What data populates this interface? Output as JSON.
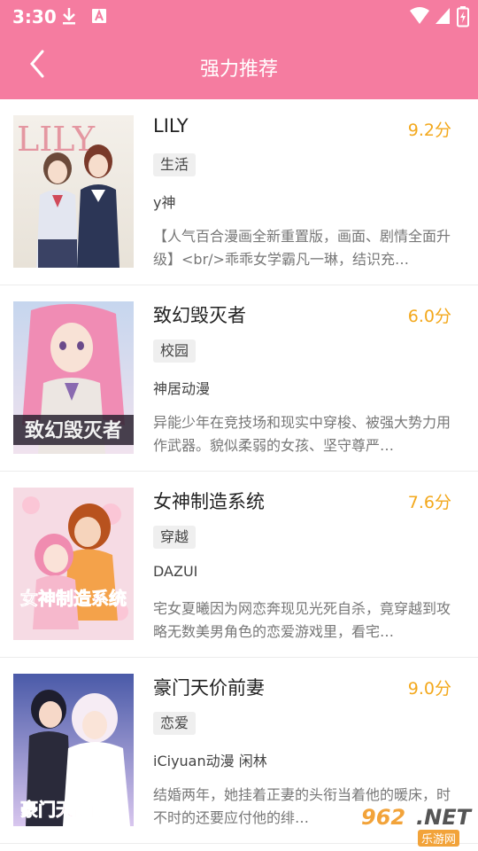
{
  "status_bar": {
    "time": "3:30"
  },
  "header": {
    "title": "强力推荐"
  },
  "comics": [
    {
      "name": "LILY",
      "score": "9.2分",
      "tag": "生活",
      "author": "y神",
      "desc": "【人气百合漫画全新重置版，画面、剧情全面升级】<br/>乖乖女学霸凡一琳，结识充…",
      "cover_text": "LILY"
    },
    {
      "name": "致幻毁灭者",
      "score": "6.0分",
      "tag": "校园",
      "author": "神居动漫",
      "desc": "异能少年在竞技场和现实中穿梭、被强大势力用作武器。貌似柔弱的女孩、坚守尊严…",
      "cover_text": "致幻毁灭者"
    },
    {
      "name": "女神制造系统",
      "score": "7.6分",
      "tag": "穿越",
      "author": "DAZUI",
      "desc": "宅女夏曦因为网恋奔现见光死自杀，竟穿越到攻略无数美男角色的恋爱游戏里，看宅…",
      "cover_text": "女神制造系统"
    },
    {
      "name": "豪门天价前妻",
      "score": "9.0分",
      "tag": "恋爱",
      "author": "iCiyuan动漫 闲林",
      "desc": "结婚两年，她挂着正妻的头衔当着他的暖床，时不时的还要应付他的绯…",
      "cover_text": "豪门天价前妻"
    }
  ],
  "watermark": {
    "number": "962",
    "net": ".NET",
    "sub": "乐游网"
  },
  "colors": {
    "header": "#f57ca0",
    "score": "#f3a81c"
  }
}
